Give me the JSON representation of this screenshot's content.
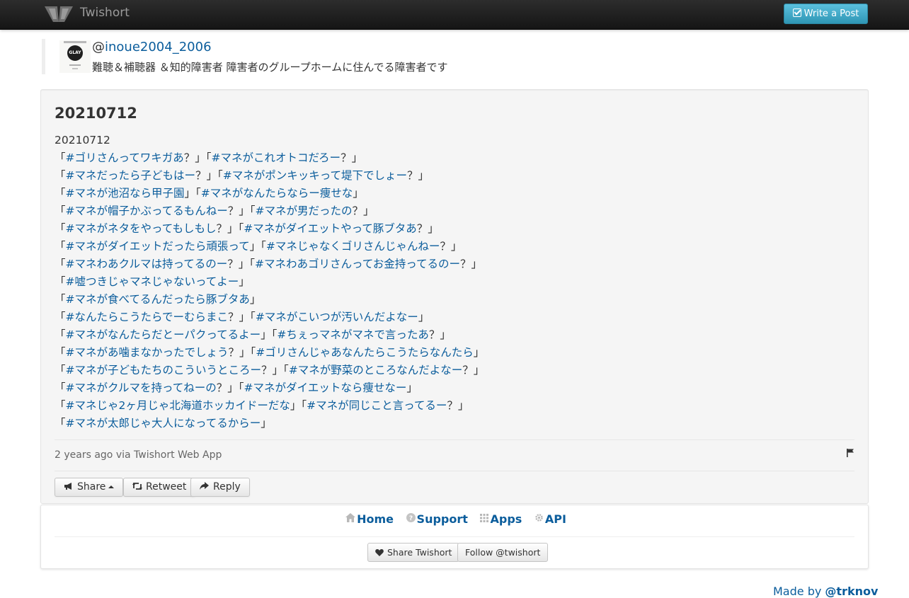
{
  "navbar": {
    "brand_name": "Twishort",
    "logo_icon": "twishort-butterfly-logo",
    "write_post_label": "Write a Post",
    "write_icon": "edit-checkbox-icon"
  },
  "author": {
    "at_sign": "@",
    "handle": "inoue2004_2006",
    "bio": "難聴＆補聴器 ＆知的障害者 障害者のグループホームに住んでる障害者です",
    "avatar_text": "GLAY"
  },
  "post": {
    "title": "20210712",
    "lines": [
      {
        "segments": [
          {
            "text": "20210712"
          }
        ]
      },
      {
        "segments": [
          {
            "text": "「"
          },
          {
            "text": "#ゴリさんってワキガあ",
            "tag": true
          },
          {
            "text": "？」「"
          },
          {
            "text": "#マネがこれオトコだろー",
            "tag": true
          },
          {
            "text": "？」"
          }
        ]
      },
      {
        "segments": [
          {
            "text": "「"
          },
          {
            "text": "#マネだったら子どもはー",
            "tag": true
          },
          {
            "text": "？」「"
          },
          {
            "text": "#マネがポンキッキって堤下でしょー",
            "tag": true
          },
          {
            "text": "？」"
          }
        ]
      },
      {
        "segments": [
          {
            "text": "「"
          },
          {
            "text": "#マネが池沼なら甲子園",
            "tag": true
          },
          {
            "text": "」「"
          },
          {
            "text": "#マネがなんたらならー痩せな",
            "tag": true
          },
          {
            "text": "」"
          }
        ]
      },
      {
        "segments": [
          {
            "text": "「"
          },
          {
            "text": "#マネが帽子かぶってるもんねー",
            "tag": true
          },
          {
            "text": "？」「"
          },
          {
            "text": "#マネが男だったの",
            "tag": true
          },
          {
            "text": "？」"
          }
        ]
      },
      {
        "segments": [
          {
            "text": "「"
          },
          {
            "text": "#マネがネタをやってもしもし",
            "tag": true
          },
          {
            "text": "？」「"
          },
          {
            "text": "#マネがダイエットやって豚ブタあ",
            "tag": true
          },
          {
            "text": "？」"
          }
        ]
      },
      {
        "segments": [
          {
            "text": "「"
          },
          {
            "text": "#マネがダイエットだったら頑張って",
            "tag": true
          },
          {
            "text": "」「"
          },
          {
            "text": "#マネじゃなくゴリさんじゃんねー",
            "tag": true
          },
          {
            "text": "？」"
          }
        ]
      },
      {
        "segments": [
          {
            "text": "「"
          },
          {
            "text": "#マネわあクルマは持ってるのー",
            "tag": true
          },
          {
            "text": "？」「"
          },
          {
            "text": "#マネわあゴリさんってお金持ってるのー",
            "tag": true
          },
          {
            "text": "？」"
          }
        ]
      },
      {
        "segments": [
          {
            "text": "「"
          },
          {
            "text": "#嘘つきじゃマネじゃないってよー",
            "tag": true
          },
          {
            "text": "」"
          }
        ]
      },
      {
        "segments": [
          {
            "text": "「"
          },
          {
            "text": "#マネが食べてるんだったら豚ブタあ",
            "tag": true
          },
          {
            "text": "」"
          }
        ]
      },
      {
        "segments": [
          {
            "text": "「"
          },
          {
            "text": "#なんたらこうたらでーむらまこ",
            "tag": true
          },
          {
            "text": "？」「"
          },
          {
            "text": "#マネがこいつが汚いんだよなー",
            "tag": true
          },
          {
            "text": "」"
          }
        ]
      },
      {
        "segments": [
          {
            "text": "「"
          },
          {
            "text": "#マネがなんたらだとーパクってるよー",
            "tag": true
          },
          {
            "text": "」「"
          },
          {
            "text": "#ちぇっマネがマネで言ったあ",
            "tag": true
          },
          {
            "text": "？」"
          }
        ]
      },
      {
        "segments": [
          {
            "text": "「"
          },
          {
            "text": "#マネがあ噛まなかったでしょう",
            "tag": true
          },
          {
            "text": "？」「"
          },
          {
            "text": "#ゴリさんじゃあなんたらこうたらなんたら",
            "tag": true
          },
          {
            "text": "」"
          }
        ]
      },
      {
        "segments": [
          {
            "text": "「"
          },
          {
            "text": "#マネが子どもたちのこういうところー",
            "tag": true
          },
          {
            "text": "？」「"
          },
          {
            "text": "#マネが野菜のところなんだよなー",
            "tag": true
          },
          {
            "text": "？」"
          }
        ]
      },
      {
        "segments": [
          {
            "text": "「"
          },
          {
            "text": "#マネがクルマを持ってねーの",
            "tag": true
          },
          {
            "text": "？」「"
          },
          {
            "text": "#マネがダイエットなら痩せなー",
            "tag": true
          },
          {
            "text": "」"
          }
        ]
      },
      {
        "segments": [
          {
            "text": "「"
          },
          {
            "text": "#マネじゃ2ヶ月じゃ北海道ホッカイドーだな",
            "tag": true
          },
          {
            "text": "」「"
          },
          {
            "text": "#マネが同じこと言ってるー",
            "tag": true
          },
          {
            "text": "？」"
          }
        ]
      },
      {
        "segments": [
          {
            "text": "「"
          },
          {
            "text": "#マネが太郎じゃ大人になってるからー",
            "tag": true
          },
          {
            "text": "」"
          }
        ]
      }
    ],
    "meta": "2 years ago via Twishort Web App",
    "flag_icon": "flag-icon",
    "share_label": "Share",
    "retweet_label": "Retweet",
    "reply_label": "Reply"
  },
  "footer": {
    "nav": [
      {
        "label": "Home",
        "icon": "home-icon"
      },
      {
        "label": "Support",
        "icon": "question-circle-icon"
      },
      {
        "label": "Apps",
        "icon": "grid-icon"
      },
      {
        "label": "API",
        "icon": "gear-icon"
      }
    ],
    "share_twishort_label": "Share Twishort",
    "follow_label": "Follow @twishort",
    "credit_prefix": "Made by ",
    "credit_handle": "@trknov"
  },
  "colors": {
    "link": "#0b5d9c",
    "navbar": "#1b1b1b",
    "accent_button": "#49afcd",
    "card_bg": "#f5f5f5"
  }
}
